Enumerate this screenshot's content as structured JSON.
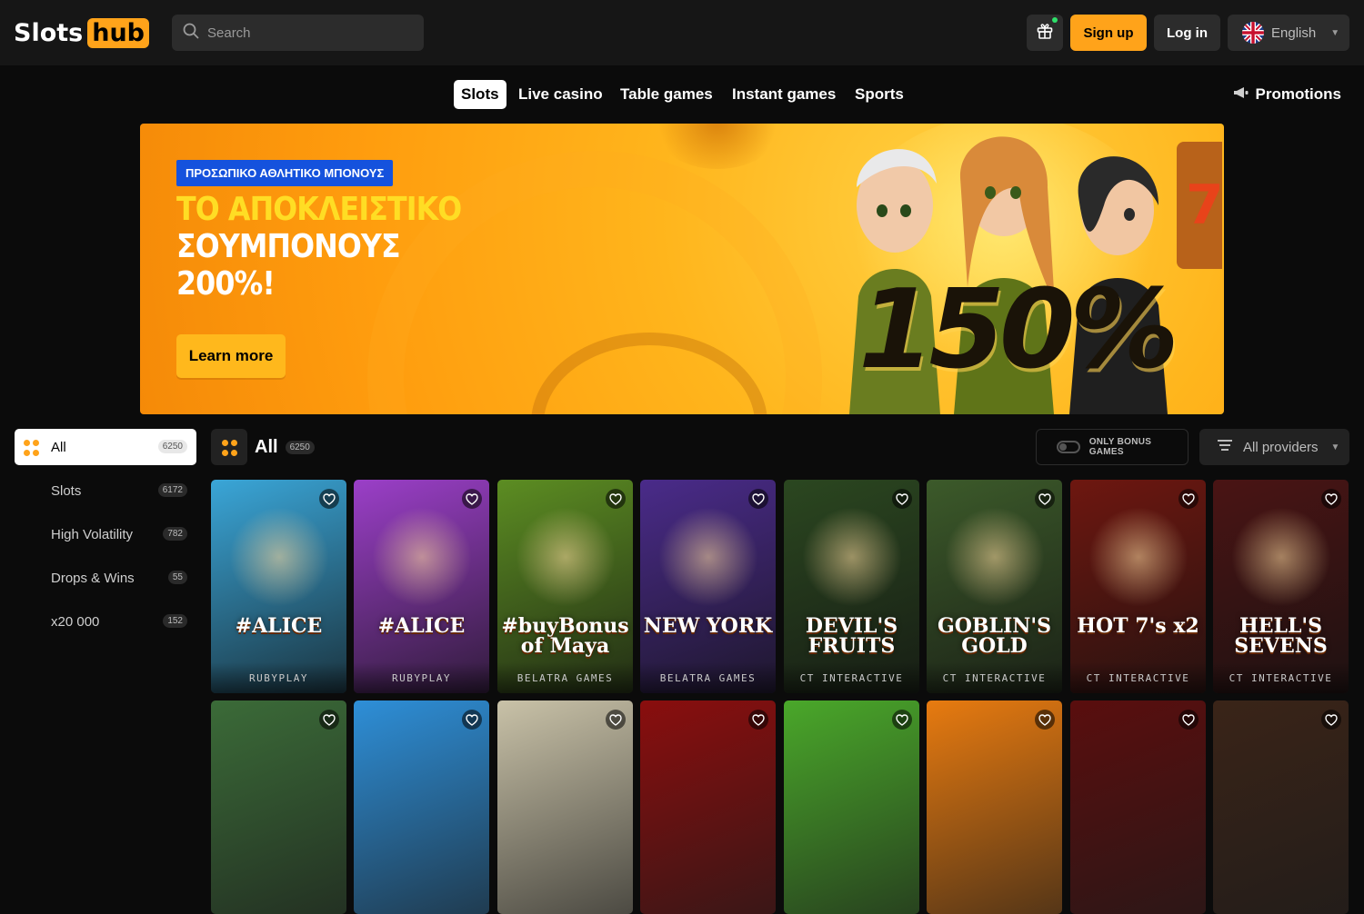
{
  "header": {
    "logo_part1": "Slots",
    "logo_part2": "hub",
    "search_placeholder": "Search",
    "signup_label": "Sign up",
    "login_label": "Log in",
    "language": "English"
  },
  "nav": {
    "tabs": [
      {
        "label": "Slots"
      },
      {
        "label": "Live casino"
      },
      {
        "label": "Table games"
      },
      {
        "label": "Instant games"
      },
      {
        "label": "Sports"
      }
    ],
    "promotions_label": "Promotions"
  },
  "banner": {
    "tag": "ΠΡΟΣΩΠΙΚΟ ΑΘΛΗΤΙΚΟ ΜΠΟΝΟΥΣ",
    "headline_line1": "ΤΟ ΑΠΟΚΛΕΙΣΤΙΚΟ",
    "headline_line2": "ΣΟΥΜΠΟΝΟΥΣ",
    "headline_line3": "200%!",
    "learn_more_label": "Learn more",
    "big_text": "150%"
  },
  "sidebar": {
    "items": [
      {
        "label": "All",
        "count": "6250"
      },
      {
        "label": "Slots",
        "count": "6172"
      },
      {
        "label": "High Volatility",
        "count": "782"
      },
      {
        "label": "Drops & Wins",
        "count": "55"
      },
      {
        "label": "x20 000",
        "count": "152"
      }
    ]
  },
  "games_header": {
    "title": "All",
    "count": "6250",
    "bonus_toggle_label": "ONLY BONUS GAMES",
    "providers_label": "All providers"
  },
  "games": [
    {
      "title": "#ALICE",
      "provider": "RUBYPLAY",
      "bg": "#3aa6d8"
    },
    {
      "title": "#ALICE",
      "provider": "RUBYPLAY",
      "bg": "#9b3fc8"
    },
    {
      "title": "#buyBonus of Maya",
      "provider": "BELATRA GAMES",
      "bg": "#5c8d22"
    },
    {
      "title": "NEW YORK",
      "provider": "BELATRA GAMES",
      "bg": "#4a2b8a"
    },
    {
      "title": "DEVIL'S FRUITS",
      "provider": "CT INTERACTIVE",
      "bg": "#2b4720"
    },
    {
      "title": "GOBLIN'S GOLD",
      "provider": "CT INTERACTIVE",
      "bg": "#3c5a2a"
    },
    {
      "title": "HOT 7's x2",
      "provider": "CT INTERACTIVE",
      "bg": "#6e1710"
    },
    {
      "title": "HELL'S SEVENS",
      "provider": "CT INTERACTIVE",
      "bg": "#4a1414"
    }
  ],
  "games_row2": [
    {
      "bg": "#3b6b38"
    },
    {
      "bg": "#2e8fd8"
    },
    {
      "bg": "#c9c2a8"
    },
    {
      "bg": "#8a0e0e"
    },
    {
      "bg": "#4aa82a"
    },
    {
      "bg": "#e87b10"
    },
    {
      "bg": "#5a0e0e"
    },
    {
      "bg": "#3a2418"
    }
  ]
}
